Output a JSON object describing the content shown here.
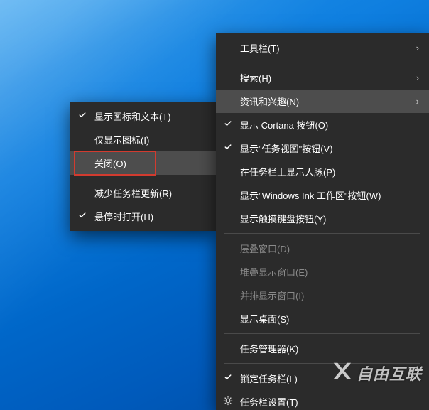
{
  "submenu": {
    "items": [
      {
        "label": "显示图标和文本(T)",
        "checked": true
      },
      {
        "label": "仅显示图标(I)",
        "checked": false
      },
      {
        "label": "关闭(O)",
        "checked": false,
        "hover": true,
        "highlight": true
      }
    ],
    "sep": true,
    "items2": [
      {
        "label": "减少任务栏更新(R)",
        "checked": false
      },
      {
        "label": "悬停时打开(H)",
        "checked": true
      }
    ]
  },
  "mainmenu": {
    "items": [
      {
        "label": "工具栏(T)",
        "submenu": true
      },
      {
        "sep": true
      },
      {
        "label": "搜索(H)",
        "submenu": true
      },
      {
        "label": "资讯和兴趣(N)",
        "submenu": true,
        "hover": true
      },
      {
        "label": "显示 Cortana 按钮(O)",
        "checked": true
      },
      {
        "label": "显示\"任务视图\"按钮(V)",
        "checked": true
      },
      {
        "label": "在任务栏上显示人脉(P)"
      },
      {
        "label": "显示\"Windows Ink 工作区\"按钮(W)"
      },
      {
        "label": "显示触摸键盘按钮(Y)"
      },
      {
        "sep": true
      },
      {
        "label": "层叠窗口(D)",
        "disabled": true
      },
      {
        "label": "堆叠显示窗口(E)",
        "disabled": true
      },
      {
        "label": "并排显示窗口(I)",
        "disabled": true
      },
      {
        "label": "显示桌面(S)"
      },
      {
        "sep": true
      },
      {
        "label": "任务管理器(K)"
      },
      {
        "sep": true
      },
      {
        "label": "锁定任务栏(L)",
        "checked": true
      },
      {
        "label": "任务栏设置(T)",
        "icon": "gear"
      }
    ]
  },
  "watermark": "自由互联"
}
